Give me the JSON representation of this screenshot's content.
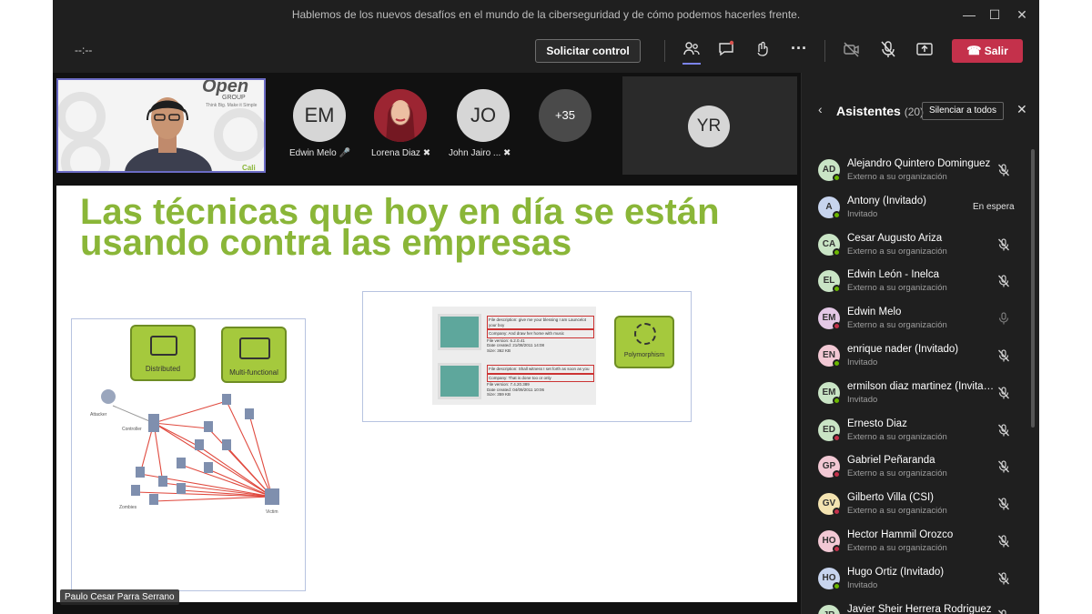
{
  "window": {
    "title": "Hablemos de los nuevos desafíos en el mundo de la ciberseguridad y de cómo podemos hacerles frente.",
    "timer": "--:--"
  },
  "toolbar": {
    "request_control": "Solicitar control",
    "leave": "Salir"
  },
  "participants_strip": [
    {
      "initials": "EM",
      "name": "Edwin Melo"
    },
    {
      "initials": "",
      "name": "Lorena Diaz"
    },
    {
      "initials": "JO",
      "name": "John Jairo ..."
    },
    {
      "initials": "+35",
      "name": ""
    },
    {
      "initials": "YR",
      "name": ""
    }
  ],
  "self_video": {
    "logo": "Open",
    "logo_sub": "GROUP",
    "tagline": "Think Big. Make it Simple",
    "city": "Cali"
  },
  "slide": {
    "title": "Las técnicas que hoy en día se están usando contra las empresas",
    "labels": {
      "distributed": "Distributed",
      "multifunctional": "Multi-functional",
      "polymorphism": "Polymorphism",
      "attacker": "Attacker",
      "controller": "Controller",
      "zombies": "Zombies",
      "victim": "Victim"
    },
    "file1": [
      "File description: give me your blessing I am Launcelot your boy",
      "Company: And draw her home with music",
      "File version: 6.2.0.41",
      "Date created: 21/08/2011 14:08",
      "Size: 362 KB"
    ],
    "file2": [
      "File description: Shall witness I set forth as soon as you",
      "Company: That is done too or only",
      "File version: 7.4.20.389",
      "Date created: 04/09/2011 10:06",
      "Size: 359 KB"
    ]
  },
  "presenter": "Paulo Cesar Parra Serrano",
  "panel": {
    "title": "Asistentes",
    "count": "(20)",
    "mute_all": "Silenciar a todos",
    "attendees": [
      {
        "initials": "AD",
        "name": "Alejandro Quintero Dominguez",
        "status": "Externo a su organización",
        "avatar_color": "#c9e4c5",
        "dot": "#6bb700",
        "action": "muted"
      },
      {
        "initials": "A",
        "name": "Antony (Invitado)",
        "status": "Invitado",
        "avatar_color": "#c7d4ee",
        "dot": "#6bb700",
        "action": "En espera"
      },
      {
        "initials": "CA",
        "name": "Cesar Augusto Ariza",
        "status": "Externo a su organización",
        "avatar_color": "#c9e4c5",
        "dot": "#6bb700",
        "action": "muted"
      },
      {
        "initials": "EL",
        "name": "Edwin León - Inelca",
        "status": "Externo a su organización",
        "avatar_color": "#c9e4c5",
        "dot": "#6bb700",
        "action": "muted"
      },
      {
        "initials": "EM",
        "name": "Edwin Melo",
        "status": "Externo a su organización",
        "avatar_color": "#e4c8e6",
        "dot": "#c4314b",
        "action": "mic"
      },
      {
        "initials": "EN",
        "name": "enrique nader (Invitado)",
        "status": "Invitado",
        "avatar_color": "#f2c8d4",
        "dot": "#6bb700",
        "action": "muted"
      },
      {
        "initials": "EM",
        "name": "ermilson diaz martinez (Invitado)",
        "status": "Invitado",
        "avatar_color": "#c9e4c5",
        "dot": "#6bb700",
        "action": "muted"
      },
      {
        "initials": "ED",
        "name": "Ernesto Diaz",
        "status": "Externo a su organización",
        "avatar_color": "#c9e4c5",
        "dot": "#c4314b",
        "action": "muted"
      },
      {
        "initials": "GP",
        "name": "Gabriel Peñaranda",
        "status": "Externo a su organización",
        "avatar_color": "#f2c8d4",
        "dot": "#c4314b",
        "action": "muted"
      },
      {
        "initials": "GV",
        "name": "Gilberto Villa (CSI)",
        "status": "Externo a su organización",
        "avatar_color": "#f3e3b0",
        "dot": "#c4314b",
        "action": "muted"
      },
      {
        "initials": "HO",
        "name": "Hector Hammil Orozco",
        "status": "Externo a su organización",
        "avatar_color": "#f2c8d4",
        "dot": "#c4314b",
        "action": "muted"
      },
      {
        "initials": "HO",
        "name": "Hugo Ortiz (Invitado)",
        "status": "Invitado",
        "avatar_color": "#c7d4ee",
        "dot": "#6bb700",
        "action": "muted"
      },
      {
        "initials": "JR",
        "name": "Javier Sheir Herrera Rodriguez",
        "status": "",
        "avatar_color": "#c9e4c5",
        "dot": "#6bb700",
        "action": "muted"
      }
    ]
  }
}
